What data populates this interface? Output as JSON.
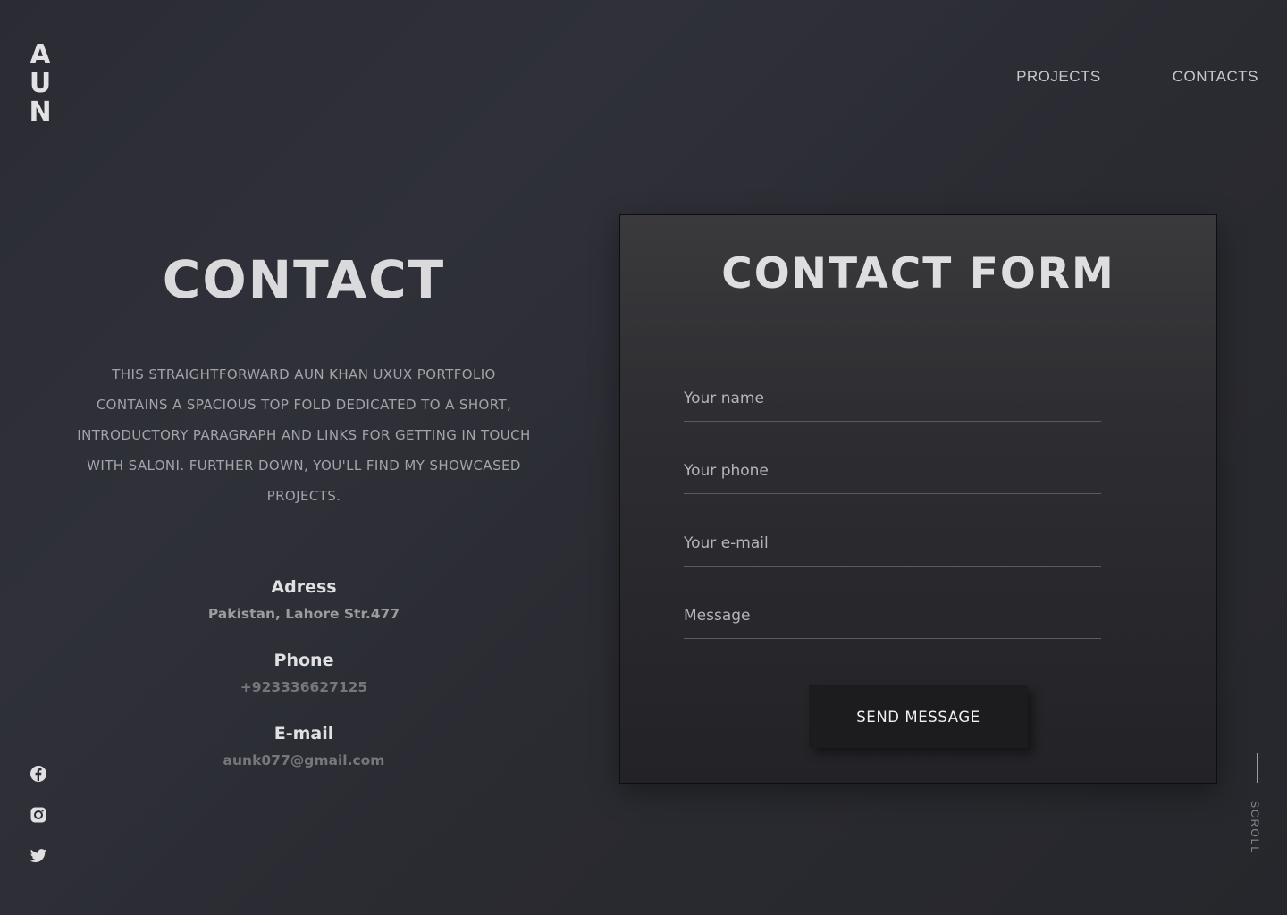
{
  "logo": {
    "letters": [
      "A",
      "U",
      "N"
    ]
  },
  "nav": {
    "projects": "PROJECTS",
    "contacts": "CONTACTS"
  },
  "contact": {
    "title": "CONTACT",
    "intro": "THIS STRAIGHTFORWARD AUN KHAN UXUX PORTFOLIO CONTAINS A SPACIOUS TOP FOLD DEDICATED TO A SHORT, INTRODUCTORY PARAGRAPH AND LINKS FOR GETTING IN TOUCH WITH SALONI. FURTHER DOWN, YOU'LL FIND MY SHOWCASED PROJECTS.",
    "address_label": "Adress",
    "address_value": "Pakistan, Lahore Str.477",
    "phone_label": "Phone",
    "phone_value": "+923336627125",
    "email_label": "E-mail",
    "email_value": "aunk077@gmail.com"
  },
  "form": {
    "title": "CONTACT FORM",
    "name_placeholder": "Your name",
    "phone_placeholder": "Your phone",
    "email_placeholder": "Your e-mail",
    "message_placeholder": "Message",
    "send_label": "SEND MESSAGE"
  },
  "social": {
    "icons": [
      "facebook-icon",
      "instagram-icon",
      "twitter-icon"
    ]
  },
  "scroll": {
    "label": "SCROLL"
  },
  "colors": {
    "background": "#2c2d34",
    "card": "#2e2e32",
    "button": "#1c1c1f"
  }
}
